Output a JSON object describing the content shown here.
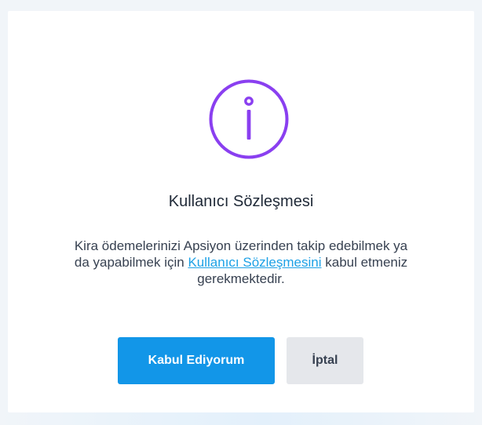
{
  "dialog": {
    "icon": "info-circle-icon",
    "title": "Kullanıcı Sözleşmesi",
    "message_before": "Kira ödemelerinizi Apsiyon üzerinden takip edebilmek ya da yapabilmek için ",
    "message_link": "Kullanıcı Sözleşmesini",
    "message_after": " kabul etmeniz gerekmektedir.",
    "accept_label": "Kabul Ediyorum",
    "cancel_label": "İptal"
  },
  "colors": {
    "icon": "#8a3ff0",
    "link": "#1da1e6",
    "accept_button": "#1296e8",
    "cancel_button": "#e5e7eb"
  }
}
